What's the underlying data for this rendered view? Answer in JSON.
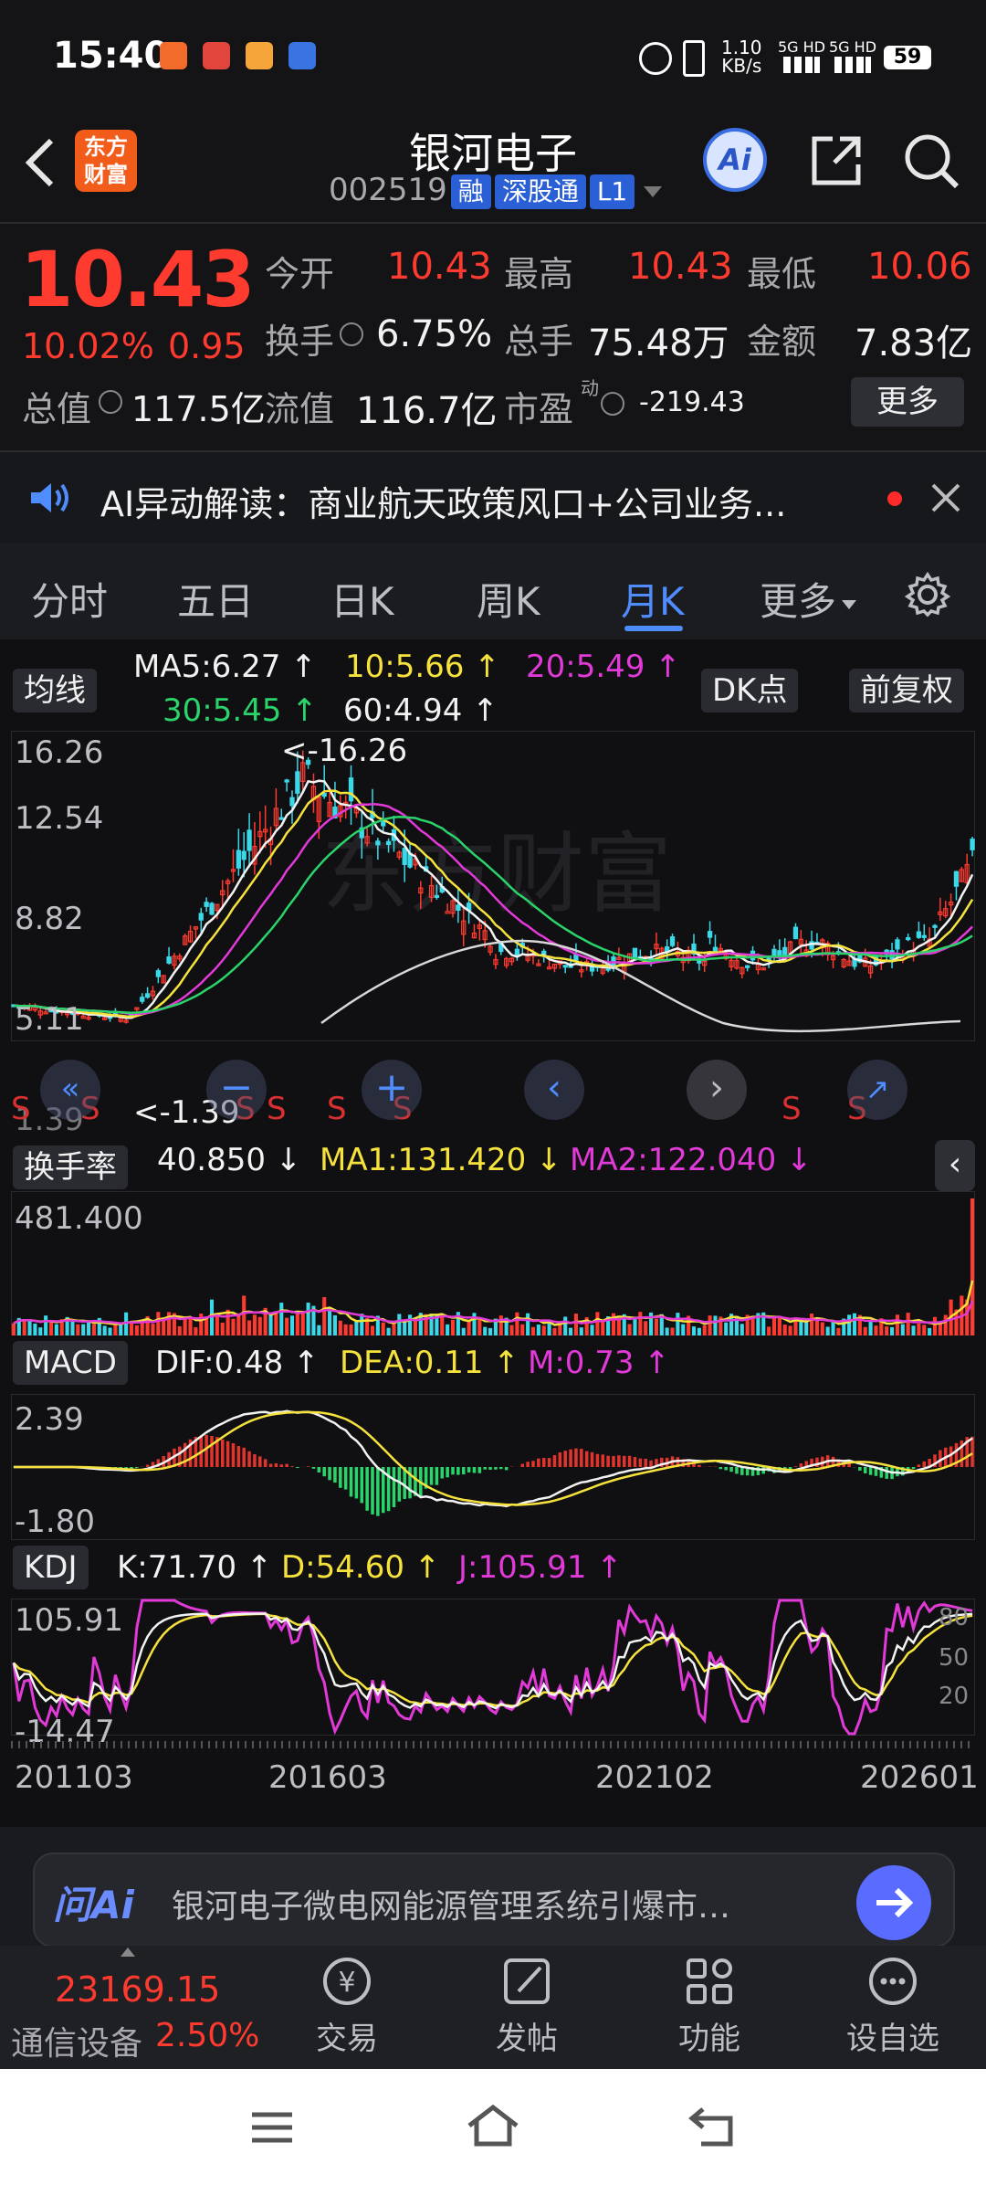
{
  "status_bar": {
    "time": "15:40",
    "net_speed": "1.10",
    "net_unit": "KB/s",
    "sig1": "5G HD",
    "sig2": "5G HD",
    "battery": "59"
  },
  "header": {
    "logo_text": "东方财富",
    "title": "银河电子",
    "code": "002519",
    "tag1": "融",
    "tag2": "深股通",
    "tag3": "L1",
    "ai_label": "Ai"
  },
  "quote": {
    "price": "10.43",
    "change_pct": "10.02%",
    "change": "0.95",
    "open_label": "今开",
    "open": "10.43",
    "high_label": "最高",
    "high": "10.43",
    "low_label": "最低",
    "low": "10.06",
    "turnover_label": "换手",
    "turnover": "6.75%",
    "volume_label": "总手",
    "volume": "75.48万",
    "amount_label": "金额",
    "amount": "7.83亿",
    "mktcap_label": "总值",
    "mktcap": "117.5亿",
    "float_label": "流值",
    "float_cap": "116.7亿",
    "pe_label": "市盈",
    "pe_sup": "动",
    "pe": "-219.43",
    "more_label": "更多"
  },
  "ai_banner": {
    "text": "AI异动解读：商业航天政策风口+公司业务..."
  },
  "tabs": [
    "分时",
    "五日",
    "日K",
    "周K",
    "月K",
    "更多"
  ],
  "main_chart": {
    "ma_selector": "均线",
    "ma5": "MA5:6.27 ↑",
    "ma10": "10:5.66 ↑",
    "ma20": "20:5.49 ↑",
    "ma30": "30:5.45 ↑",
    "ma60": "60:4.94 ↑",
    "dk_label": "DK点",
    "fq_label": "前复权",
    "y_ticks": [
      "16.26",
      "12.54",
      "8.82",
      "5.11"
    ],
    "low_tick": "1.39",
    "max_marker": "<-16.26",
    "min_marker": "<-1.39",
    "s_marks": [
      "S",
      "S",
      "S",
      "S",
      "S",
      "S",
      "S",
      "S",
      "S"
    ],
    "watermark": "东方财富"
  },
  "turnover_chart": {
    "selector": "换手率",
    "value": "40.850 ↓",
    "ma1": "MA1:131.420 ↓",
    "ma2": "MA2:122.040 ↓",
    "y_tick": "481.400"
  },
  "macd_chart": {
    "selector": "MACD",
    "dif": "DIF:0.48 ↑",
    "dea": "DEA:0.11 ↑",
    "m": "M:0.73 ↑",
    "y_top": "2.39",
    "y_bottom": "-1.80"
  },
  "kdj_chart": {
    "selector": "KDJ",
    "k": "K:71.70 ↑",
    "d": "D:54.60 ↑",
    "j": "J:105.91 ↑",
    "y_top": "105.91",
    "y_bottom": "-14.47",
    "r80": "80",
    "r50": "50",
    "r20": "20"
  },
  "x_axis": [
    "201103",
    "201603",
    "202102",
    "202601"
  ],
  "ask_ai": {
    "logo": "问Ai",
    "text": "银河电子微电网能源管理系统引爆市…"
  },
  "bottom_nav": {
    "index_value": "23169.15",
    "index_name": "通信设备",
    "index_pct": "2.50%",
    "items": [
      "交易",
      "发帖",
      "功能",
      "设自选"
    ]
  },
  "colors": {
    "up": "#ff3b30",
    "down": "#2bd46b",
    "ma5": "#ffffff",
    "ma10": "#f6e23c",
    "ma20": "#e23ad8",
    "ma30": "#2bd46b",
    "ma60": "#f2f2f2",
    "accent": "#4f8dff"
  }
}
